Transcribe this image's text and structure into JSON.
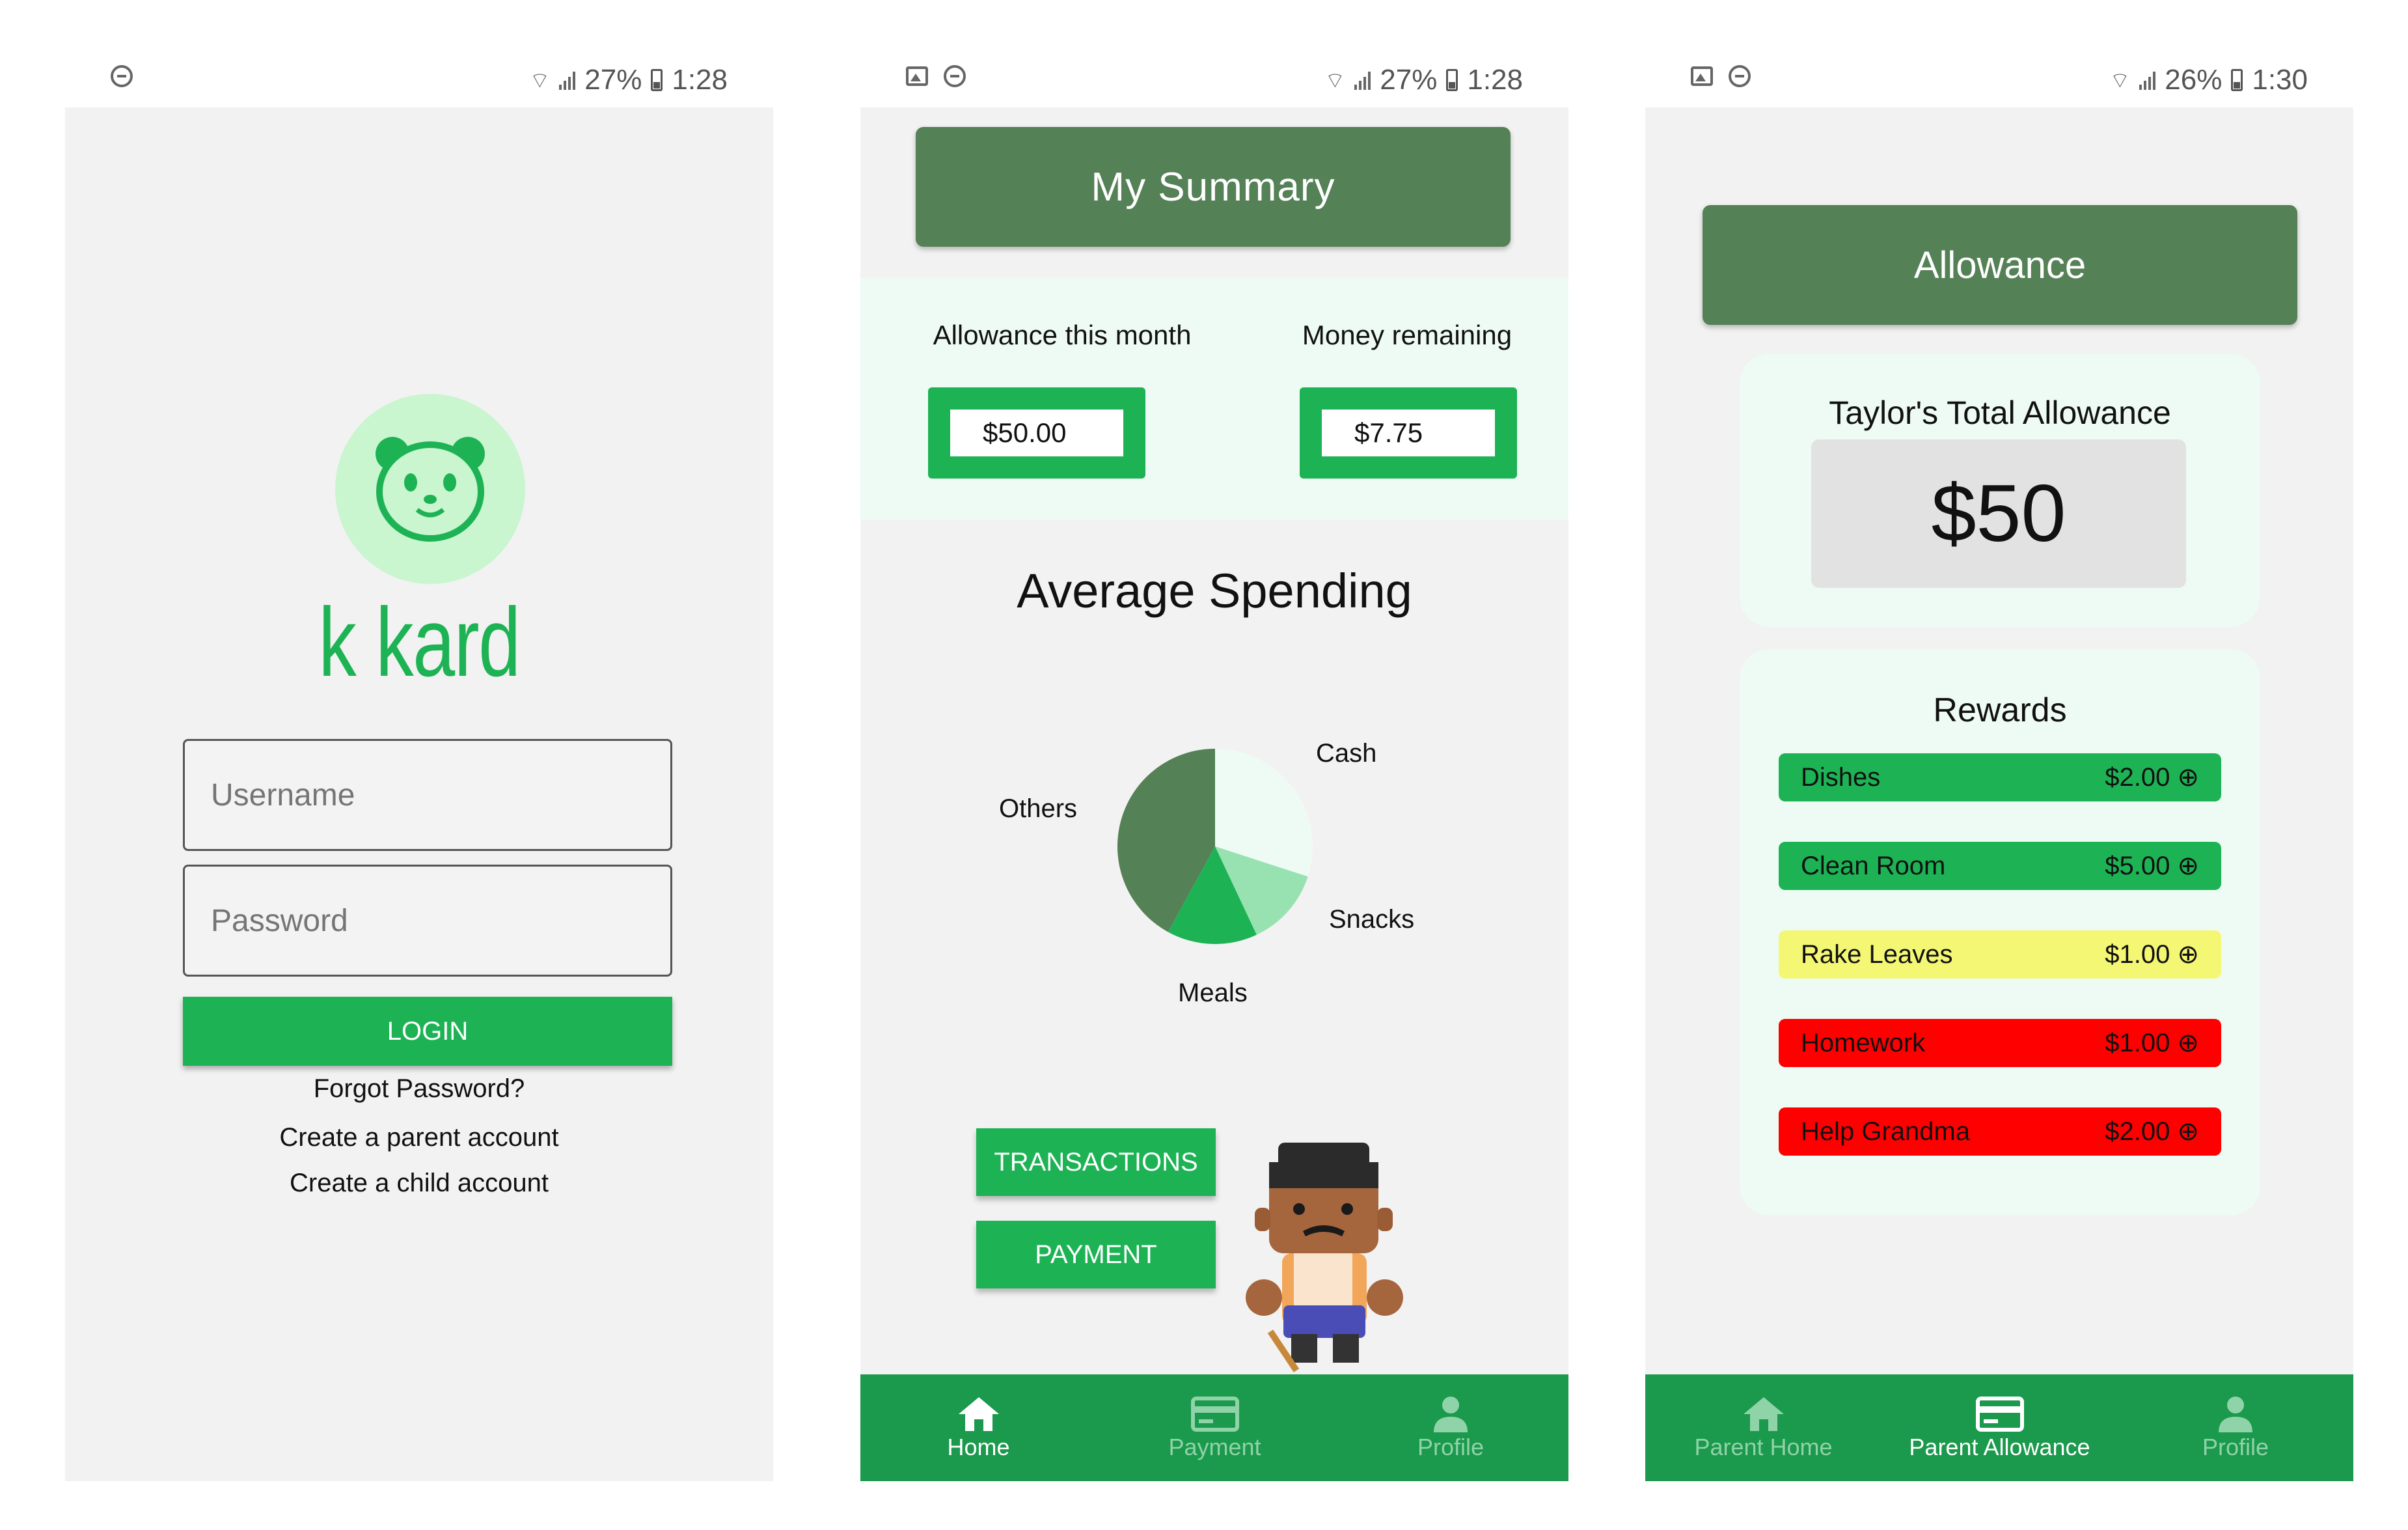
{
  "status": {
    "s1": {
      "battery": "27%",
      "time": "1:28"
    },
    "s2": {
      "battery": "27%",
      "time": "1:28"
    },
    "s3": {
      "battery": "26%",
      "time": "1:30"
    }
  },
  "login": {
    "brand": "k kard",
    "username_placeholder": "Username",
    "password_placeholder": "Password",
    "login_label": "LOGIN",
    "forgot": "Forgot Password?",
    "create_parent": "Create a parent account",
    "create_child": "Create a child account"
  },
  "summary": {
    "title": "My Summary",
    "allowance_label": "Allowance this month",
    "allowance_value": "$50.00",
    "remaining_label": "Money remaining",
    "remaining_value": "$7.75",
    "spending_title": "Average Spending",
    "transactions_label": "TRANSACTIONS",
    "payment_label": "PAYMENT"
  },
  "chart_data": {
    "type": "pie",
    "title": "Average Spending",
    "labels": [
      "Cash",
      "Snacks",
      "Meals",
      "Others"
    ],
    "values": [
      30,
      13,
      15,
      42
    ],
    "colors": [
      "#eefbf4",
      "#98e2b1",
      "#1db355",
      "#558156"
    ]
  },
  "allowance": {
    "title": "Allowance",
    "total_label": "Taylor's Total Allowance",
    "total_value": "$50",
    "rewards_title": "Rewards",
    "rewards": [
      {
        "name": "Dishes",
        "amount": "$2.00 ⊕",
        "color": "#1db355"
      },
      {
        "name": "Clean Room",
        "amount": "$5.00 ⊕",
        "color": "#1db355"
      },
      {
        "name": "Rake Leaves",
        "amount": "$1.00 ⊕",
        "color": "#f4f774"
      },
      {
        "name": "Homework",
        "amount": "$1.00 ⊕",
        "color": "#ff0000"
      },
      {
        "name": "Help Grandma",
        "amount": "$2.00 ⊕",
        "color": "#ff0000"
      }
    ]
  },
  "nav1": {
    "home": "Home",
    "payment": "Payment",
    "profile": "Profile"
  },
  "nav2": {
    "home": "Parent Home",
    "allowance": "Parent Allowance",
    "profile": "Profile"
  },
  "colors": {
    "accent": "#1db355",
    "header": "#558156",
    "navbar": "#1b994c",
    "panel": "#eefbf4"
  }
}
